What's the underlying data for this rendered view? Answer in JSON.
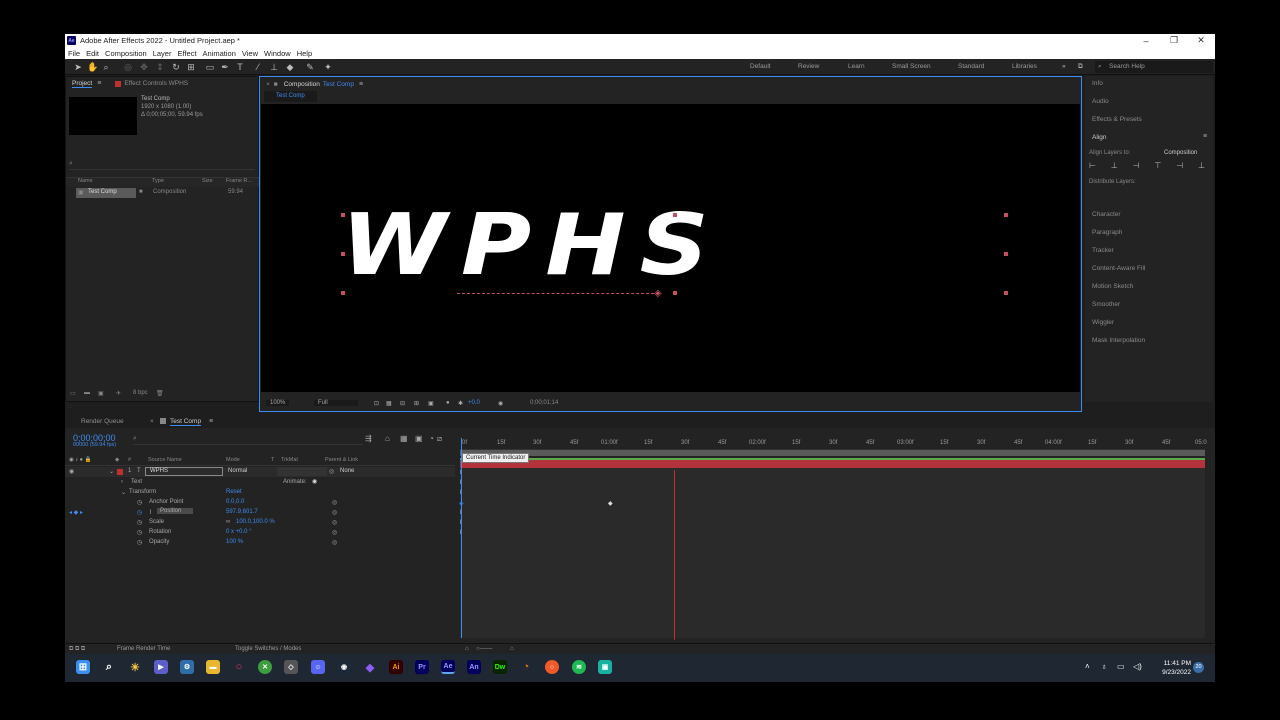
{
  "window": {
    "title": "Adobe After Effects 2022 - Untitled Project.aep *",
    "app_badge": "Ae"
  },
  "menu": [
    "File",
    "Edit",
    "Composition",
    "Layer",
    "Effect",
    "Animation",
    "View",
    "Window",
    "Help"
  ],
  "workspaces": [
    "Default",
    "Review",
    "Learn",
    "Small Screen",
    "Standard",
    "Libraries"
  ],
  "search_help": "Search Help",
  "project": {
    "tabs": [
      "Project",
      "Effect Controls WPHS"
    ],
    "item_name": "Test Comp",
    "item_dims": "1920 x 1080 (1.00)",
    "item_duration": "Δ 0;00;05;00, 59.94 fps",
    "columns": [
      "Name",
      "Type",
      "Size",
      "Frame R..."
    ],
    "row": {
      "name": "Test Comp",
      "type": "Composition",
      "fps": "59.94"
    },
    "bpc": "8 bpc"
  },
  "composition": {
    "tab_label": "Composition",
    "tab_comp": "Test Comp",
    "breadcrumb": "Test Comp",
    "text": "WPHS",
    "zoom": "100%",
    "resolution": "Full",
    "exposure": "+0.0",
    "timecode": "0;00;01;14"
  },
  "right_panels": {
    "top": [
      "Info",
      "Audio",
      "Effects & Presets"
    ],
    "align_title": "Align",
    "align_layers_to_label": "Align Layers to:",
    "align_layers_to_value": "Composition",
    "distribute_label": "Distribute Layers:",
    "bottom": [
      "Character",
      "Paragraph",
      "Tracker",
      "Content-Aware Fill",
      "Motion Sketch",
      "Smoother",
      "Wiggler",
      "Mask Interpolation"
    ]
  },
  "timeline": {
    "render_queue": "Render Queue",
    "comp_tab": "Test Comp",
    "timecode": "0;00;00;00",
    "timecode_sub": "00000 (59.94 fps)",
    "columns": [
      "Source Name",
      "Mode",
      "T",
      "TrkMat",
      "Parent & Link"
    ],
    "layer": {
      "index": "1",
      "name": "WPHS",
      "mode": "Normal",
      "parent": "None"
    },
    "text_label": "Text",
    "animate_label": "Animate:",
    "transform_label": "Transform",
    "reset_label": "Reset",
    "properties": [
      {
        "name": "Anchor Point",
        "value": "0.0,0.0"
      },
      {
        "name": "Position",
        "value": "597.9,601.7"
      },
      {
        "name": "Scale",
        "value": "100.0,100.0 %"
      },
      {
        "name": "Rotation",
        "value": "0 x +0.0 °"
      },
      {
        "name": "Opacity",
        "value": "100 %"
      }
    ],
    "ruler": [
      "0f",
      "15f",
      "30f",
      "45f",
      "01:00f",
      "15f",
      "30f",
      "45f",
      "02:00f",
      "15f",
      "30f",
      "45f",
      "03:00f",
      "15f",
      "30f",
      "45f",
      "04:00f",
      "15f",
      "30f",
      "45f",
      "05:0"
    ],
    "tooltip": "Current Time Indicator",
    "footer_left": "Frame Render Time",
    "footer_mid": "Toggle Switches / Modes"
  },
  "taskbar": {
    "time": "11:41 PM",
    "date": "9/23/2022",
    "apps": [
      "Ai",
      "Pr",
      "Ae",
      "An",
      "Dw"
    ],
    "notification_count": "20"
  },
  "colors": {
    "accent": "#3d8cf1",
    "layer_bar": "#b3333c",
    "handle": "#c65060"
  }
}
